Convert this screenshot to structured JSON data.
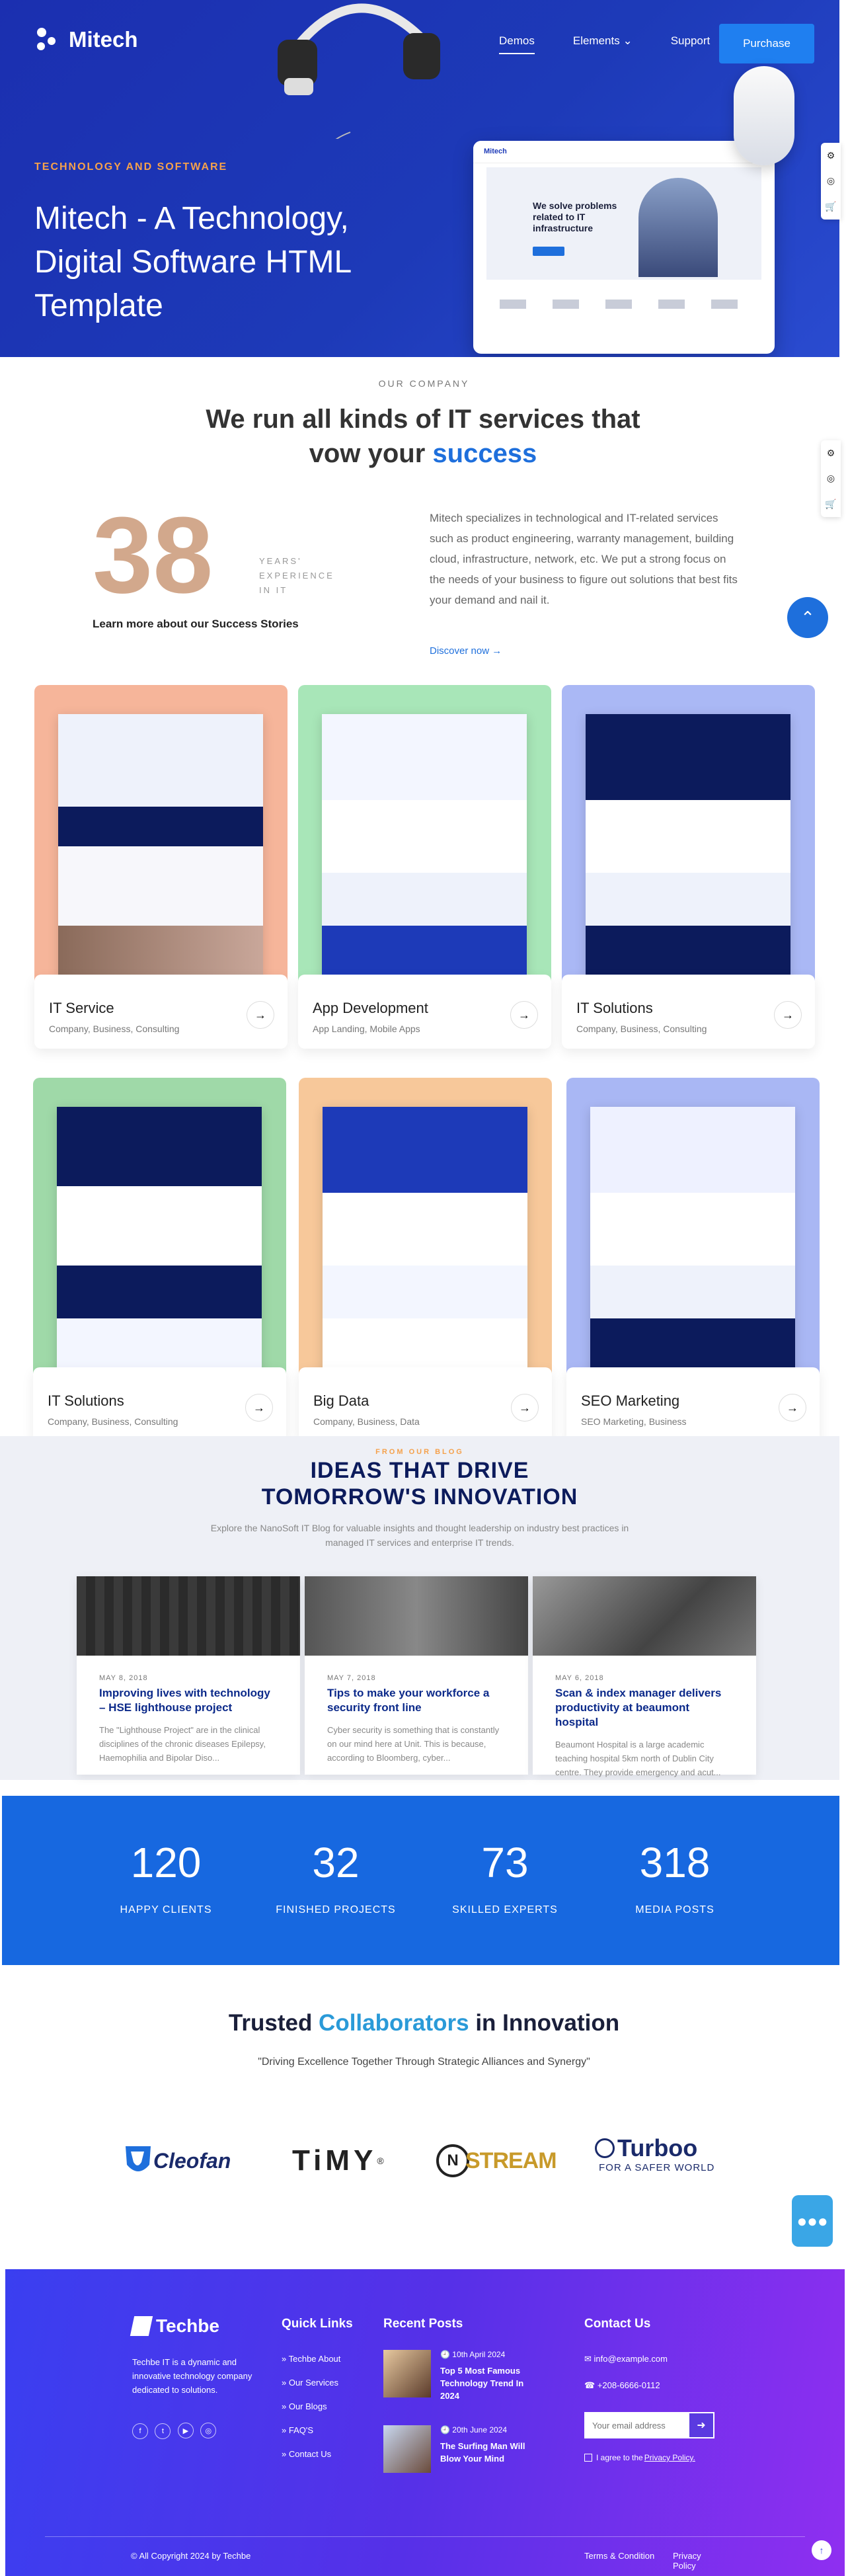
{
  "hero": {
    "brand": "Mitech",
    "nav": [
      "Demos",
      "Elements ⌄",
      "Support"
    ],
    "purchase": "Purchase",
    "kicker": "TECHNOLOGY AND SOFTWARE",
    "title": "Mitech - A Technology, Digital Software HTML Template",
    "preview_brand": "Mitech",
    "preview_heading": "We solve problems related to IT infrastructure"
  },
  "company": {
    "kicker": "OUR COMPANY",
    "title_a": "We run all kinds of IT services that",
    "title_b": "vow your ",
    "title_hl": "success",
    "number": "38",
    "years_1": "YEARS'",
    "years_2": "EXPERIENCE",
    "years_3": "IN IT",
    "stories": "Learn more about our Success Stories",
    "text": "Mitech specializes in technological and IT-related services such as product engineering, warranty management, building cloud, infrastructure, network, etc. We put a strong focus on the needs of your business to figure out solutions that best fits your demand and nail it.",
    "discover": "Discover now →"
  },
  "demos": [
    {
      "title": "IT Service",
      "sub": "Company, Business, Consulting",
      "bg": "#f6b59a"
    },
    {
      "title": "App Development",
      "sub": "App Landing, Mobile Apps",
      "bg": "#a8e6b8"
    },
    {
      "title": "IT Solutions",
      "sub": "Company, Business, Consulting",
      "bg": "#aab8f5"
    },
    {
      "title": "IT Solutions",
      "sub": "Company, Business, Consulting",
      "bg": "#9fd9a8"
    },
    {
      "title": "Big Data",
      "sub": "Company, Business, Data",
      "bg": "#f7c89a"
    },
    {
      "title": "SEO Marketing",
      "sub": "SEO Marketing, Business",
      "bg": "#a9b7f4"
    }
  ],
  "blog": {
    "kicker": "FROM OUR BLOG",
    "title_1": "IDEAS THAT DRIVE",
    "title_2": "TOMORROW'S INNOVATION",
    "sub": "Explore the NanoSoft IT Blog for valuable insights and thought leadership on industry best practices in managed IT services and enterprise IT trends.",
    "posts": [
      {
        "date": "MAY 8, 2018",
        "title": "Improving lives with technology – HSE lighthouse project",
        "excerpt": "The \"Lighthouse Project\" are in the clinical disciplines of the chronic diseases Epilepsy, Haemophilia and Bipolar Diso..."
      },
      {
        "date": "MAY 7, 2018",
        "title": "Tips to make your workforce a security front line",
        "excerpt": "Cyber security is something that is constantly on our mind here at Unit. This is because, according to Bloomberg, cyber..."
      },
      {
        "date": "MAY 6, 2018",
        "title": "Scan & index manager delivers productivity at beaumont hospital",
        "excerpt": "Beaumont Hospital is a large academic teaching hospital 5km north of Dublin City centre. They provide emergency and acut..."
      }
    ]
  },
  "stats": [
    {
      "n": "120",
      "l": "HAPPY CLIENTS"
    },
    {
      "n": "32",
      "l": "FINISHED PROJECTS"
    },
    {
      "n": "73",
      "l": "SKILLED EXPERTS"
    },
    {
      "n": "318",
      "l": "MEDIA POSTS"
    }
  ],
  "collab": {
    "a": "Trusted ",
    "hl": "Collaborators",
    "b": " in Innovation",
    "sub": "\"Driving Excellence Together Through Strategic Alliances and Synergy\"",
    "brands": [
      "Cleofan",
      "TiMY",
      "STREAM",
      "Turboo",
      "FOR A SAFER WORLD"
    ]
  },
  "footer": {
    "brand": "Techbe",
    "about": "Techbe IT is a dynamic and innovative technology company dedicated to solutions.",
    "quick_h": "Quick Links",
    "quick": [
      "Techbe About",
      "Our Services",
      "Our Blogs",
      "FAQ'S",
      "Contact Us"
    ],
    "recent_h": "Recent Posts",
    "recent": [
      {
        "date": "10th April 2024",
        "title": "Top 5 Most Famous Technology Trend In 2024"
      },
      {
        "date": "20th June 2024",
        "title": "The Surfing Man Will Blow Your Mind"
      }
    ],
    "contact_h": "Contact Us",
    "email": "info@example.com",
    "phone": "+208-6666-0112",
    "email_placeholder": "Your email address",
    "agree_a": "I agree to the ",
    "agree_link": "Privacy Policy.",
    "copyright": "© All Copyright 2024 by Techbe",
    "terms": "Terms & Condition",
    "privacy": "Privacy Policy"
  },
  "colors": {
    "hero": "#1d3ab8",
    "accent": "#1e6fdc",
    "number": "#d2a88c",
    "stats": "#1768e0"
  }
}
